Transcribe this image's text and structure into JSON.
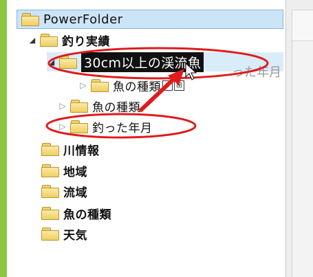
{
  "tree": {
    "root": {
      "label": "PowerFolder",
      "icon": "folder-icon"
    },
    "items": [
      {
        "label": "釣り実績",
        "expander": "◢",
        "bold": true
      },
      {
        "label": "30cm以上の渓流魚",
        "expander": "◢"
      },
      {
        "label": "魚の種類",
        "expander": "▷"
      },
      {
        "label": "魚の種類",
        "expander": "▷"
      },
      {
        "label": "釣った年月",
        "expander": "▷"
      },
      {
        "label": "川情報"
      },
      {
        "label": "地域"
      },
      {
        "label": "流域"
      },
      {
        "label": "魚の種類"
      },
      {
        "label": "天気"
      }
    ],
    "ghost_text": "った年月",
    "drop_badge_plus": "⊞"
  },
  "annotations": {
    "color": "#e01b1b"
  }
}
